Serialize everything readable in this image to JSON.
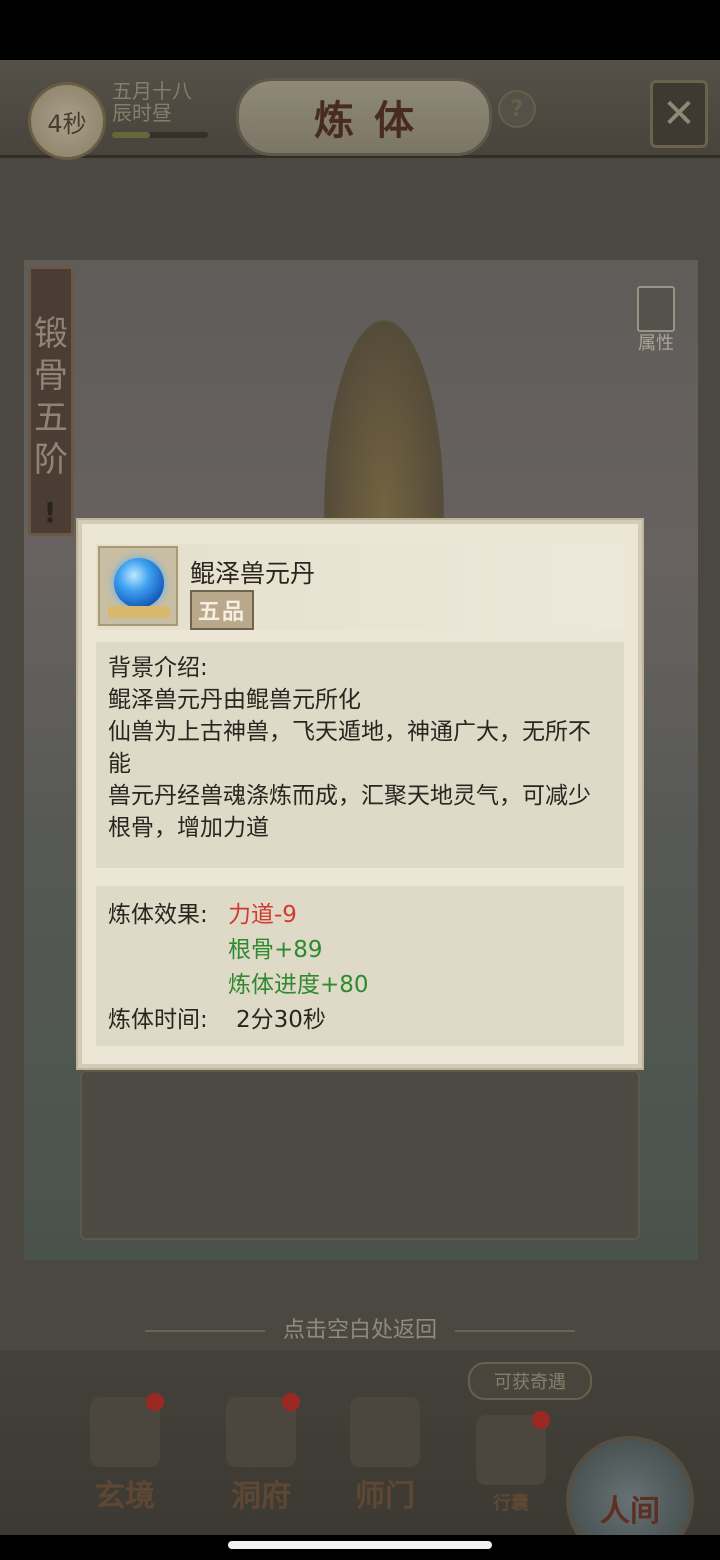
{
  "header": {
    "timer": "4秒",
    "date_line1": "五月十八",
    "date_line2": "辰时昼",
    "title": "炼体",
    "help_symbol": "?",
    "close_icon": "close-icon",
    "time_progress": 0.4
  },
  "side": {
    "stage_label": "锻骨五阶",
    "alert_symbol": "!",
    "attr_label": "属性"
  },
  "item": {
    "name": "鲲泽兽元丹",
    "grade": "五品",
    "icon": "blue-orb-icon",
    "background_title": "背景介绍:",
    "background_lines": [
      "鲲泽兽元丹由鲲兽元所化",
      "仙兽为上古神兽，飞天遁地，神通广大，无所不能",
      "兽元丹经兽魂涤炼而成，汇聚天地灵气，可减少根骨，增加力道"
    ],
    "effect_label": "炼体效果:",
    "effects": [
      {
        "text": "力道-9",
        "color": "#d33a2f"
      },
      {
        "text": "根骨+89",
        "color": "#2f8a2f"
      },
      {
        "text": "炼体进度+80",
        "color": "#2f8a2f"
      }
    ],
    "time_label": "炼体时间:",
    "time_value": "2分30秒"
  },
  "return_hint": "点击空白处返回",
  "bottom_nav": {
    "encounter_label": "可获奇遇",
    "items": [
      {
        "label": "玄境",
        "badge": true
      },
      {
        "label": "洞府",
        "badge": true
      },
      {
        "label": "师门",
        "badge": false
      },
      {
        "label": "行囊",
        "badge": true
      }
    ],
    "world_label": "人间"
  }
}
